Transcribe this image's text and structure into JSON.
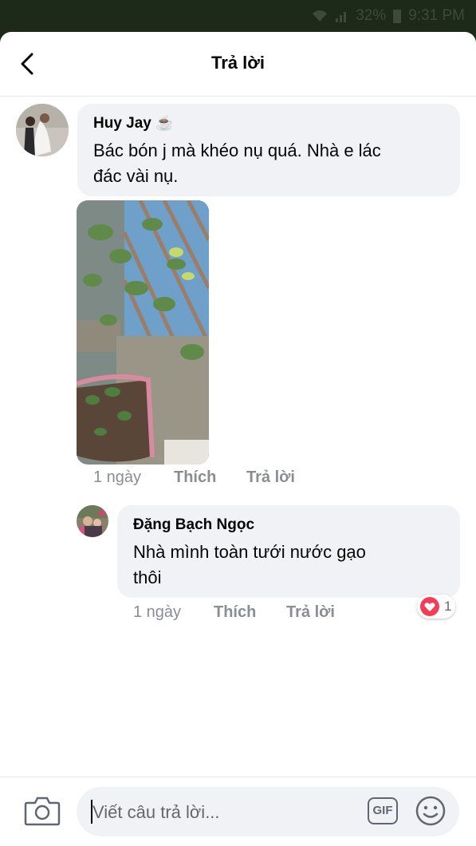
{
  "status": {
    "battery": "32%",
    "time": "9:31 PM"
  },
  "header": {
    "title": "Trả lời"
  },
  "comment": {
    "author": "Huy Jay",
    "author_badge": "☕",
    "text_line1": "Bác bón j mà khéo nụ quá. Nhà e lác",
    "text_line2": "đác vài nụ.",
    "time": "1 ngày",
    "like_label": "Thích",
    "reply_label": "Trả lời"
  },
  "reply": {
    "author": "Đặng Bạch Ngọc",
    "text_line1": "Nhà mình toàn tưới nước gạo",
    "text_line2": "thôi",
    "time": "1 ngày",
    "like_label": "Thích",
    "reply_label": "Trả lời",
    "reaction_icon": "heart-icon",
    "reaction_count": "1"
  },
  "composer": {
    "placeholder": "Viết câu trả lời...",
    "gif_label": "GIF"
  },
  "colors": {
    "heart": "#f33e58",
    "meta": "#8a8d91",
    "bubble": "#f0f2f5"
  }
}
